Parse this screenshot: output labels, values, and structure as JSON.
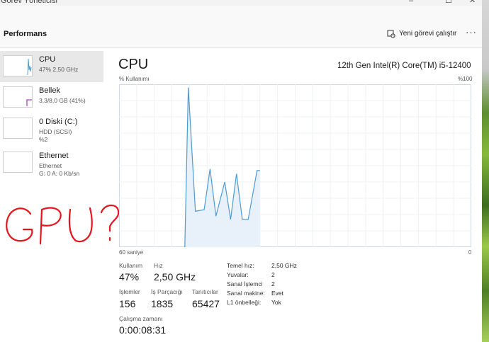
{
  "window": {
    "title": "Görev Yöneticisi",
    "minimize_icon": "–",
    "maximize_icon": "☐",
    "close_icon": "✕"
  },
  "header": {
    "section_title": "Performans",
    "new_task_label": "Yeni görevi çalıştır",
    "more_label": "···"
  },
  "sidebar": {
    "items": [
      {
        "name": "CPU",
        "line1": "47% 2,50 GHz",
        "line2": ""
      },
      {
        "name": "Bellek",
        "line1": "3,3/8,0 GB (41%)",
        "line2": ""
      },
      {
        "name": "0 Diski (C:)",
        "line1": "HDD (SCSI)",
        "line2": "%2"
      },
      {
        "name": "Ethernet",
        "line1": "Ethernet",
        "line2": "G: 0 A: 0 Kb/sn"
      }
    ]
  },
  "annotation": {
    "text": "GPU?",
    "color": "#e8141b"
  },
  "main": {
    "title": "CPU",
    "model": "12th Gen Intel(R) Core(TM) i5-12400",
    "usage_label": "% Kullanımı",
    "max_label": "%100",
    "time_label": "60 saniye",
    "zero_label": "0"
  },
  "chart_data": {
    "type": "area",
    "x_range_seconds": [
      60,
      0
    ],
    "ylim": [
      0,
      100
    ],
    "grid": true,
    "x": [
      48.8,
      48.2,
      47.0,
      45.5,
      44.5,
      43.5,
      42.0,
      41.0,
      40.0,
      39.0,
      38.0,
      36.5,
      36.0
    ],
    "values": [
      0,
      98,
      22,
      23,
      48,
      19,
      40,
      17,
      45,
      17,
      17,
      47,
      47
    ],
    "line_color": "#4e9bd4",
    "fill_color": "#e8f1f9"
  },
  "stats": {
    "usage": {
      "label": "Kullanım",
      "value": "47%"
    },
    "speed": {
      "label": "Hız",
      "value": "2,50 GHz"
    },
    "processes": {
      "label": "İşlemler",
      "value": "156"
    },
    "threads": {
      "label": "İş Parçacığı",
      "value": "1835"
    },
    "handles": {
      "label": "Tanıtıcılar",
      "value": "65427"
    },
    "uptime": {
      "label": "Çalışma zamanı",
      "value": "0:00:08:31"
    }
  },
  "specs": [
    {
      "label": "Temel hız:",
      "value": "2,50 GHz"
    },
    {
      "label": "Yuvalar:",
      "value": "2"
    },
    {
      "label": "Sanal İşlemci",
      "value": "2"
    },
    {
      "label": "Sanal makine:",
      "value": "Evet"
    },
    {
      "label": "L1 önbelleği:",
      "value": "Yok"
    }
  ],
  "colors": {
    "cpu_thumb": "#4e9bd4",
    "memory_thumb": "#9b3fb5"
  }
}
